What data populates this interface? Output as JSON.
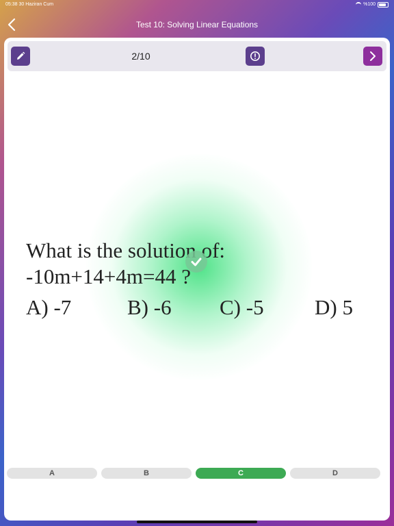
{
  "status_bar": {
    "time": "05:38",
    "date": "30 Haziran Cum",
    "battery": "%100"
  },
  "nav": {
    "title": "Test 10: Solving Linear Equations"
  },
  "toolbar": {
    "counter": "2/10"
  },
  "question": {
    "line1": "What is the solution of:",
    "line2": "-10m+14+4m=44 ?",
    "answers": {
      "a": "A) -7",
      "b": "B) -6",
      "c": "C) -5",
      "d": "D) 5"
    }
  },
  "choices": {
    "a": "A",
    "b": "B",
    "c": "C",
    "d": "D",
    "selected": "C"
  },
  "colors": {
    "accent": "#5c3f8d",
    "next": "#8e2f9d",
    "correct": "#3daa54"
  }
}
